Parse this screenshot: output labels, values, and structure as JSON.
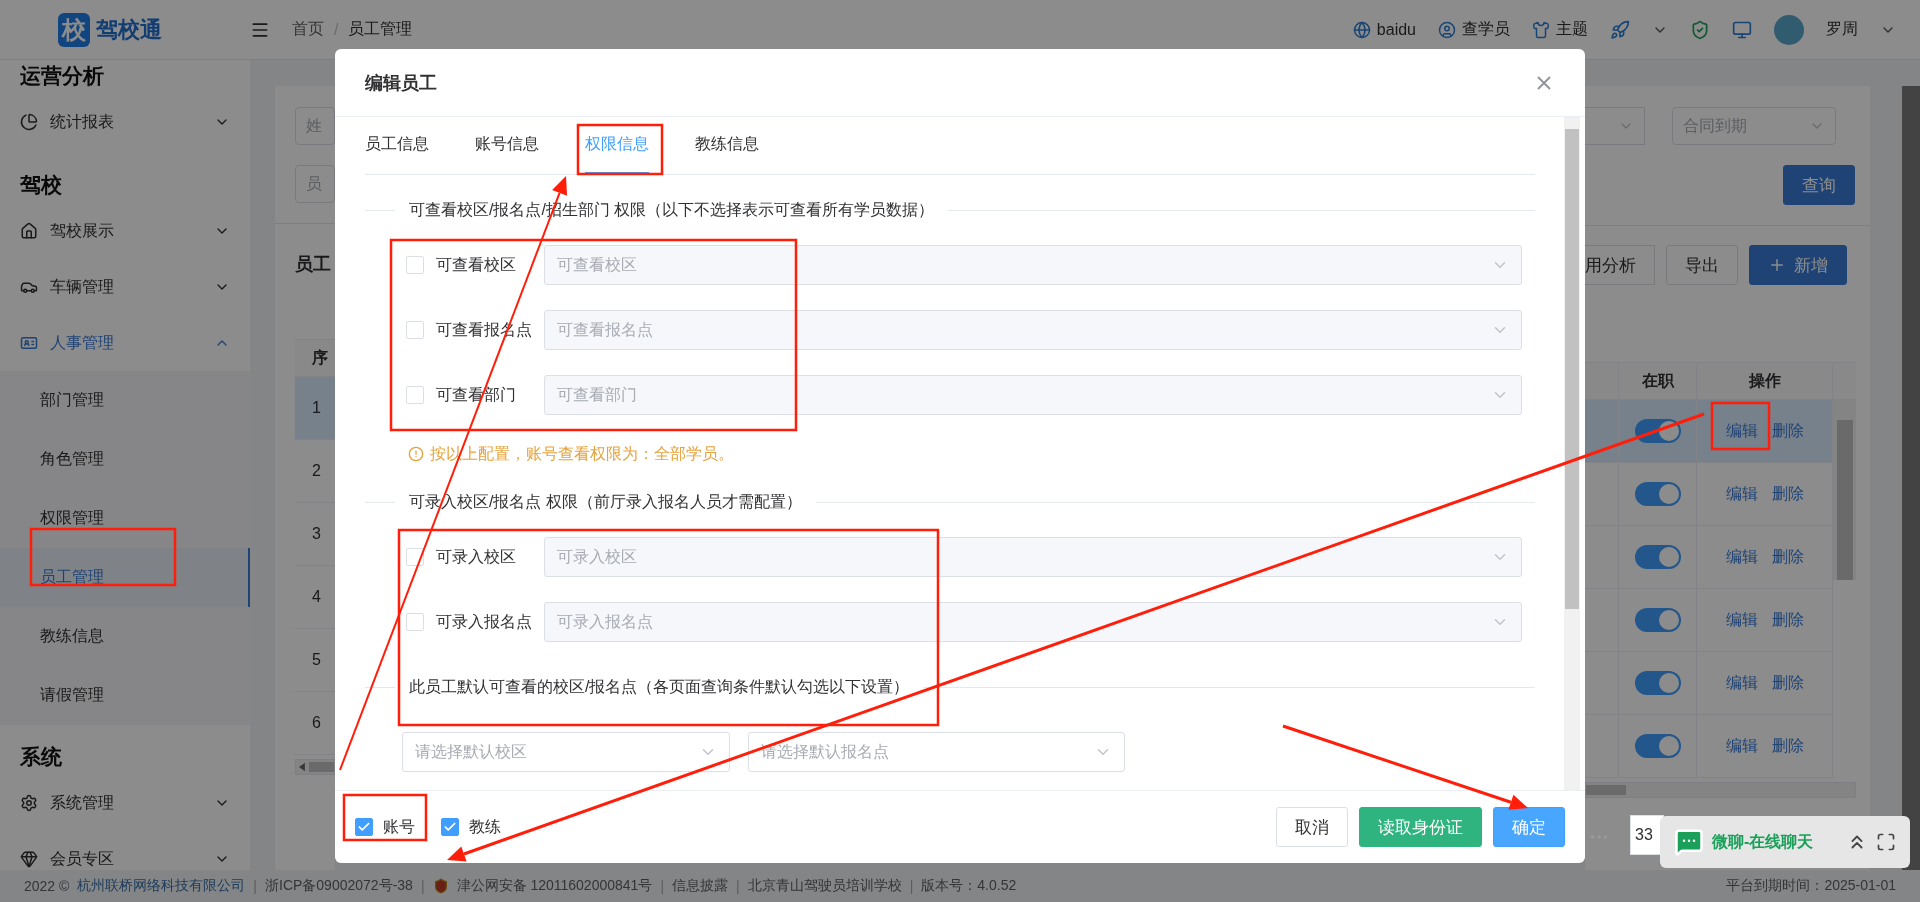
{
  "header": {
    "logo_mark": "校",
    "logo_text": "驾校通",
    "breadcrumb": [
      "首页",
      "员工管理"
    ],
    "breadcrumb_separator": "/",
    "links": [
      {
        "kind": "browser",
        "label": "baidu"
      },
      {
        "kind": "student",
        "label": "查学员"
      },
      {
        "kind": "theme",
        "label": "主题"
      }
    ],
    "user": "罗周"
  },
  "sidebar": {
    "sections": [
      {
        "title": "运营分析",
        "items": [
          {
            "label": "统计报表",
            "kind": "chart",
            "expanded": false,
            "selected": false
          }
        ]
      },
      {
        "title": "驾校",
        "items": [
          {
            "label": "驾校展示",
            "kind": "school",
            "expanded": false,
            "selected": false
          },
          {
            "label": "车辆管理",
            "kind": "car",
            "expanded": false,
            "selected": false
          },
          {
            "label": "人事管理",
            "kind": "hr",
            "expanded": true,
            "selected": true,
            "children": [
              {
                "label": "部门管理",
                "selected": false
              },
              {
                "label": "角色管理",
                "selected": false
              },
              {
                "label": "权限管理",
                "selected": false
              },
              {
                "label": "员工管理",
                "selected": true
              },
              {
                "label": "教练信息",
                "selected": false
              },
              {
                "label": "请假管理",
                "selected": false
              }
            ]
          }
        ]
      },
      {
        "title": "系统",
        "items": [
          {
            "label": "系统管理",
            "kind": "settings",
            "expanded": false,
            "selected": false
          },
          {
            "label": "会员专区",
            "kind": "member",
            "expanded": false,
            "selected": false
          }
        ]
      }
    ]
  },
  "list_page": {
    "filters_left": [
      "姓",
      "员"
    ],
    "filter_right": "合同到期",
    "search_button": "查询",
    "title": "员工",
    "toolbar": [
      "用分析",
      "导出",
      "新增"
    ],
    "columns": {
      "index": "序",
      "on_job": "在职",
      "actions": "操作"
    },
    "rows": [
      {
        "index": "1",
        "selected": true,
        "on_job": true,
        "actions": [
          "编辑",
          "删除"
        ]
      },
      {
        "index": "2",
        "selected": false,
        "on_job": true,
        "actions": [
          "编辑",
          "删除"
        ]
      },
      {
        "index": "3",
        "selected": false,
        "on_job": true,
        "actions": [
          "编辑",
          "删除"
        ]
      },
      {
        "index": "4",
        "selected": false,
        "on_job": true,
        "actions": [
          "编辑",
          "删除"
        ]
      },
      {
        "index": "5",
        "selected": false,
        "on_job": true,
        "actions": [
          "编辑",
          "删除"
        ]
      },
      {
        "index": "6",
        "selected": false,
        "on_job": true,
        "actions": [
          "编辑",
          "删除"
        ]
      }
    ],
    "page_size": "33"
  },
  "modal": {
    "title": "编辑员工",
    "tabs": [
      {
        "label": "员工信息",
        "selected": false
      },
      {
        "label": "账号信息",
        "selected": false
      },
      {
        "label": "权限信息",
        "selected": true
      },
      {
        "label": "教练信息",
        "selected": false
      }
    ],
    "sections": [
      {
        "heading": "可查看校区/报名点/招生部门 权限（以下不选择表示可查看所有学员数据）",
        "rows": [
          {
            "label": "可查看校区",
            "checked": false,
            "placeholder": "可查看校区"
          },
          {
            "label": "可查看报名点",
            "checked": false,
            "placeholder": "可查看报名点"
          },
          {
            "label": "可查看部门",
            "checked": false,
            "placeholder": "可查看部门"
          }
        ],
        "notice": "按以上配置，账号查看权限为：全部学员。"
      },
      {
        "heading": "可录入校区/报名点 权限（前厅录入报名人员才需配置）",
        "rows": [
          {
            "label": "可录入校区",
            "checked": false,
            "placeholder": "可录入校区"
          },
          {
            "label": "可录入报名点",
            "checked": false,
            "placeholder": "可录入报名点"
          }
        ]
      },
      {
        "heading": "此员工默认可查看的校区/报名点（各页面查询条件默认勾选以下设置）",
        "selects": [
          {
            "placeholder": "请选择默认校区"
          },
          {
            "placeholder": "请选择默认报名点"
          }
        ]
      }
    ],
    "footer_checks": [
      {
        "label": "账号",
        "checked": true
      },
      {
        "label": "教练",
        "checked": true
      }
    ],
    "buttons": [
      {
        "label": "取消",
        "kind": "default"
      },
      {
        "label": "读取身份证",
        "kind": "success"
      },
      {
        "label": "确定",
        "kind": "primary"
      }
    ]
  },
  "chat": {
    "label": "微聊-在线聊天"
  },
  "footer": {
    "copyright": "2022 ©",
    "company": "杭州联桥网络科技有限公司",
    "separator": "|",
    "items": [
      {
        "text": "浙ICP备09002072号-38"
      },
      {
        "text": "津公网安备 12011602000841号",
        "kind": "police"
      },
      {
        "text": "信息披露"
      },
      {
        "text": "北京青山驾驶员培训学校"
      },
      {
        "text": "版本号：4.0.52"
      }
    ],
    "expiry": "平台到期时间：2025-01-01"
  }
}
